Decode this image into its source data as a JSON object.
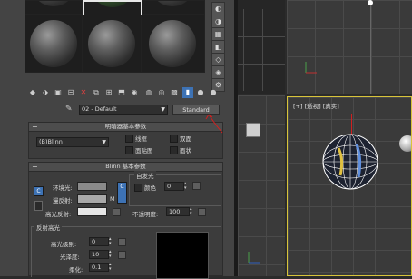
{
  "material_editor": {
    "material_name": "02 - Default",
    "material_type": "Standard",
    "shader_rollout": {
      "title": "明暗器基本参数",
      "shader": "(B)Blinn",
      "options": [
        "线框",
        "双面",
        "面贴图",
        "面状"
      ]
    },
    "blinn_rollout": {
      "title": "Blinn 基本参数",
      "ambient": "环境光:",
      "diffuse": "漫反射:",
      "specular": "高光反射:",
      "lock_letter": "C",
      "map_letter": "M",
      "self_illum_group": "自发光",
      "color_label": "颜色",
      "color_value": "0",
      "opacity_label": "不透明度:",
      "opacity_value": "100"
    },
    "specular_group": {
      "title": "反射高光",
      "level_label": "高光级别:",
      "level_value": "0",
      "gloss_label": "光泽度:",
      "gloss_value": "10",
      "soften_label": "柔化:",
      "soften_value": "0.1"
    }
  },
  "viewports": {
    "perspective_label": "[+] [透视] [真实]"
  },
  "colors": {
    "accent": "#3d72b4",
    "arrow": "#d02020",
    "ambient_swatch": "#8a8a8a",
    "diffuse_swatch": "#a9a9a9",
    "specular_swatch": "#e6e6e6"
  }
}
